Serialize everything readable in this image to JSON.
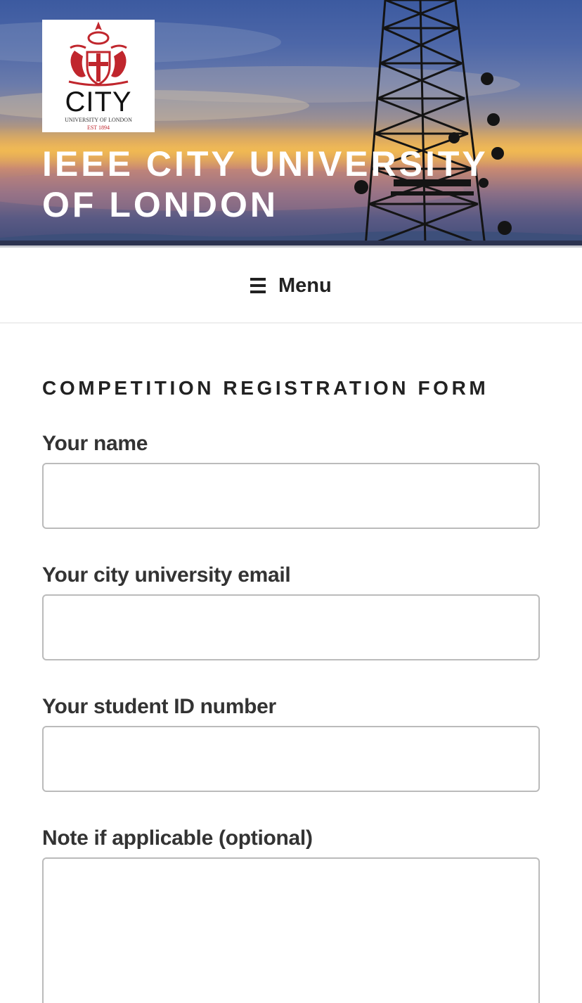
{
  "header": {
    "logo": {
      "icon": "city-university-crest-icon",
      "wordmark": "CITY",
      "subline": "UNIVERSITY OF LONDON",
      "established": "EST 1894",
      "brand_color": "#c0262d"
    },
    "site_title": "IEEE CITY UNIVERSITY OF LONDON"
  },
  "nav": {
    "menu_icon": "hamburger-icon",
    "menu_label": "Menu"
  },
  "main": {
    "page_title": "COMPETITION REGISTRATION FORM",
    "form": {
      "fields": [
        {
          "label": "Your name",
          "value": "",
          "placeholder": ""
        },
        {
          "label": "Your city university email",
          "value": "",
          "placeholder": ""
        },
        {
          "label": "Your student ID number",
          "value": "",
          "placeholder": ""
        },
        {
          "label": "Note if applicable (optional)",
          "value": "",
          "placeholder": ""
        }
      ]
    }
  }
}
